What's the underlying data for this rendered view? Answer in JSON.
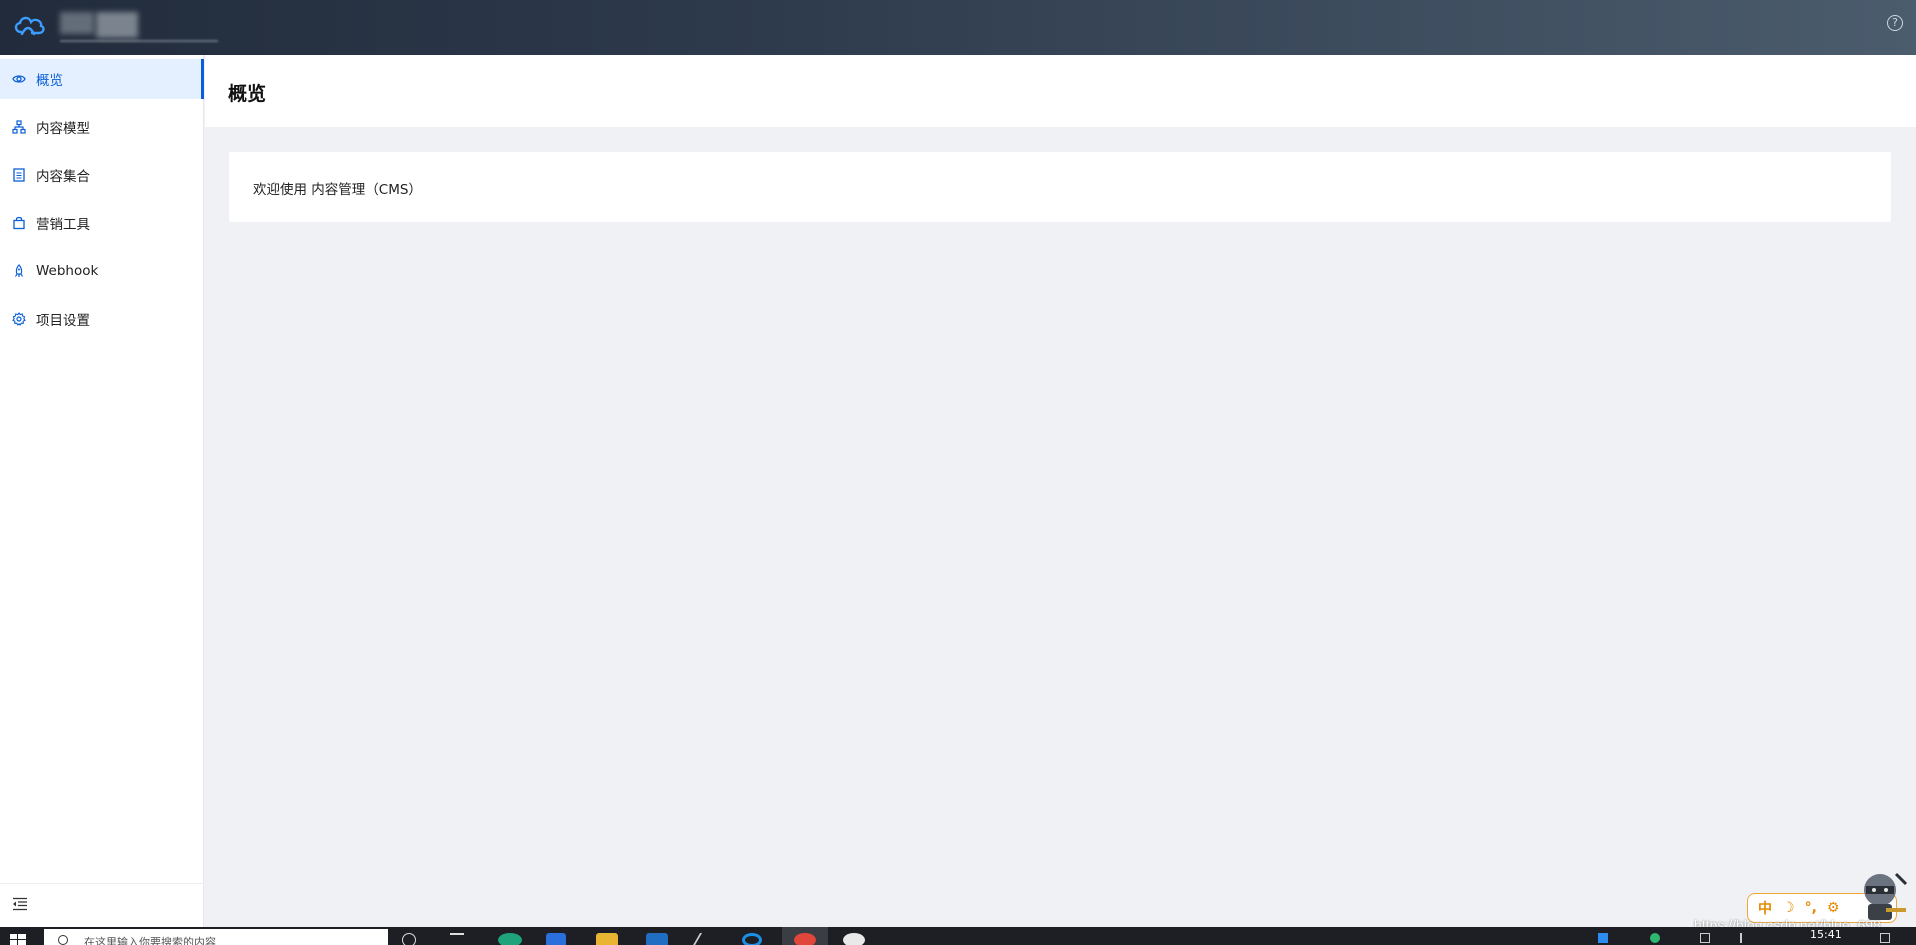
{
  "header": {
    "help_icon": "question-circle-icon",
    "logo_icon": "cloud-logo-icon",
    "accent": "#4aa3ff"
  },
  "sidebar": {
    "items": [
      {
        "label": "概览",
        "icon": "eye-icon",
        "active": true
      },
      {
        "label": "内容模型",
        "icon": "sitemap-icon",
        "active": false
      },
      {
        "label": "内容集合",
        "icon": "list-doc-icon",
        "active": false
      },
      {
        "label": "营销工具",
        "icon": "bag-icon",
        "active": false
      },
      {
        "label": "Webhook",
        "icon": "rocket-icon",
        "active": false
      },
      {
        "label": "项目设置",
        "icon": "gear-icon",
        "active": false
      }
    ],
    "collapse_icon": "menu-fold-icon",
    "active_color": "#0b5fd6"
  },
  "main": {
    "title": "概览",
    "welcome": "欢迎使用 内容管理（CMS）"
  },
  "ime": {
    "items": [
      "中",
      "☽",
      "°,",
      "⚙"
    ]
  },
  "watermark": "https://blog.csdn.net/blue_698",
  "taskbar": {
    "search_placeholder": "在这里输入你要搜索的内容",
    "clock": "15:41"
  }
}
